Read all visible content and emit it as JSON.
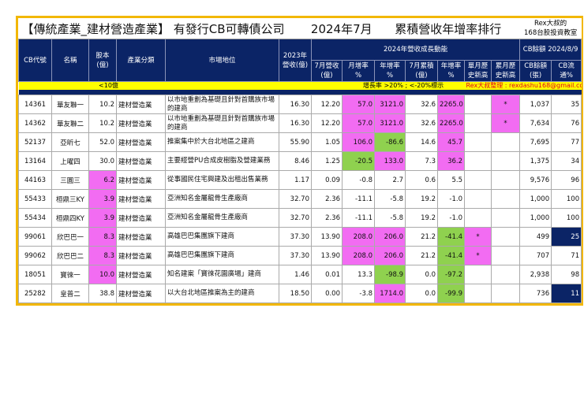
{
  "title": {
    "text": "【傳統產業_建材營造產業】 有發行CB可轉債公司       2024年7月      累積營收年增率排行",
    "brand_line1": "Rex大叔的",
    "brand_line2": "168台股投資教室"
  },
  "header": {
    "cb_code": "CB代號",
    "name": "名稱",
    "capital": "股本(億)",
    "industry": "產業分類",
    "market": "市場地位",
    "rev2023": "2023年營收(億)",
    "group2024": "2024年營收成長動能",
    "group_cb": "CB餘額 2024/8/9",
    "jul_rev": "7月營收(億)",
    "mom": "月增率 %",
    "yoy": "年增率 %",
    "jul_cum": "7月累積(億)",
    "cum_yoy": "年增率 %",
    "month_high": "單月歷史新高",
    "cum_high": "累月歷史新高",
    "cb_bal": "CB餘額(張)",
    "cb_float": "CB流通%"
  },
  "legend": {
    "small_cap": "<10億",
    "growth_note": "增長率 >20% ; <-20%標示",
    "contact": "Rex大叔整理 : rexdashu168@gmail.com"
  },
  "colors": {
    "pink": "#f26cf2",
    "green": "#8fd14f",
    "navy": "#0b2466",
    "border": "#f2b705"
  },
  "rows": [
    {
      "code": "14361",
      "name": "華友聯一",
      "capital": "10.2",
      "industry": "建材營造業",
      "market": "以市地重劃為基礎且針對首購族市場的建商",
      "rev2023": "16.30",
      "jul_rev": "12.20",
      "mom": "57.0",
      "yoy": "3121.0",
      "jul_cum": "32.6",
      "cum_yoy": "2265.0",
      "month_high": "",
      "cum_high": "*",
      "cb_bal": "1,037",
      "cb_float": "35",
      "hl": {
        "mom": "pink",
        "yoy": "pink",
        "cum_yoy": "pink",
        "cum_high": "pink"
      }
    },
    {
      "code": "14362",
      "name": "華友聯二",
      "capital": "10.2",
      "industry": "建材營造業",
      "market": "以市地重劃為基礎且針對首購族市場的建商",
      "rev2023": "16.30",
      "jul_rev": "12.20",
      "mom": "57.0",
      "yoy": "3121.0",
      "jul_cum": "32.6",
      "cum_yoy": "2265.0",
      "month_high": "",
      "cum_high": "*",
      "cb_bal": "7,634",
      "cb_float": "76",
      "hl": {
        "mom": "pink",
        "yoy": "pink",
        "cum_yoy": "pink",
        "cum_high": "pink"
      }
    },
    {
      "code": "52137",
      "name": "亞昕七",
      "capital": "52.0",
      "industry": "建材營造業",
      "market": "推案集中於大台北地區之建商",
      "rev2023": "55.90",
      "jul_rev": "1.05",
      "mom": "106.0",
      "yoy": "-86.6",
      "jul_cum": "14.6",
      "cum_yoy": "45.7",
      "month_high": "",
      "cum_high": "",
      "cb_bal": "7,695",
      "cb_float": "77",
      "hl": {
        "mom": "pink",
        "yoy": "green",
        "cum_yoy": "pink"
      }
    },
    {
      "code": "13164",
      "name": "上曜四",
      "capital": "30.0",
      "industry": "建材營造業",
      "market": "主要經營PU合成皮樹脂及營建業務",
      "rev2023": "8.46",
      "jul_rev": "1.25",
      "mom": "-20.5",
      "yoy": "133.0",
      "jul_cum": "7.3",
      "cum_yoy": "36.2",
      "month_high": "",
      "cum_high": "",
      "cb_bal": "1,375",
      "cb_float": "34",
      "hl": {
        "mom": "green",
        "yoy": "pink",
        "cum_yoy": "pink"
      }
    },
    {
      "code": "44163",
      "name": "三圓三",
      "capital": "6.2",
      "industry": "建材營造業",
      "market": "從事國民住宅興建及出租出售業務",
      "rev2023": "1.17",
      "jul_rev": "0.09",
      "mom": "-0.8",
      "yoy": "2.7",
      "jul_cum": "0.6",
      "cum_yoy": "5.5",
      "month_high": "",
      "cum_high": "",
      "cb_bal": "9,576",
      "cb_float": "96",
      "hl": {
        "capital": "pink"
      }
    },
    {
      "code": "55433",
      "name": "桓鼎三KY",
      "capital": "3.9",
      "industry": "建材營造業",
      "market": "亞洲知名金屬龍骨生產廠商",
      "rev2023": "32.70",
      "jul_rev": "2.36",
      "mom": "-11.1",
      "yoy": "-5.8",
      "jul_cum": "19.2",
      "cum_yoy": "-1.0",
      "month_high": "",
      "cum_high": "",
      "cb_bal": "1,000",
      "cb_float": "100",
      "hl": {
        "capital": "pink"
      }
    },
    {
      "code": "55434",
      "name": "桓鼎四KY",
      "capital": "3.9",
      "industry": "建材營造業",
      "market": "亞洲知名金屬龍骨生產廠商",
      "rev2023": "32.70",
      "jul_rev": "2.36",
      "mom": "-11.1",
      "yoy": "-5.8",
      "jul_cum": "19.2",
      "cum_yoy": "-1.0",
      "month_high": "",
      "cum_high": "",
      "cb_bal": "1,000",
      "cb_float": "100",
      "hl": {
        "capital": "pink"
      }
    },
    {
      "code": "99061",
      "name": "欣巴巴一",
      "capital": "8.3",
      "industry": "建材營造業",
      "market": "高雄巴巴集團旗下建商",
      "rev2023": "37.30",
      "jul_rev": "13.90",
      "mom": "208.0",
      "yoy": "206.0",
      "jul_cum": "21.2",
      "cum_yoy": "-41.4",
      "month_high": "*",
      "cum_high": "",
      "cb_bal": "499",
      "cb_float": "25",
      "hl": {
        "capital": "pink",
        "mom": "pink",
        "yoy": "pink",
        "cum_yoy": "green",
        "month_high": "pink",
        "cb_float": "navy"
      }
    },
    {
      "code": "99062",
      "name": "欣巴巴二",
      "capital": "8.3",
      "industry": "建材營造業",
      "market": "高雄巴巴集團旗下建商",
      "rev2023": "37.30",
      "jul_rev": "13.90",
      "mom": "208.0",
      "yoy": "206.0",
      "jul_cum": "21.2",
      "cum_yoy": "-41.4",
      "month_high": "*",
      "cum_high": "",
      "cb_bal": "707",
      "cb_float": "71",
      "hl": {
        "capital": "pink",
        "mom": "pink",
        "yoy": "pink",
        "cum_yoy": "green",
        "month_high": "pink"
      }
    },
    {
      "code": "18051",
      "name": "寶徠一",
      "capital": "10.0",
      "industry": "建材營造業",
      "market": "知名建案「寶徠花園廣場」建商",
      "rev2023": "1.46",
      "jul_rev": "0.01",
      "mom": "13.3",
      "yoy": "-98.9",
      "jul_cum": "0.0",
      "cum_yoy": "-97.2",
      "month_high": "",
      "cum_high": "",
      "cb_bal": "2,938",
      "cb_float": "98",
      "hl": {
        "capital": "pink",
        "yoy": "green",
        "cum_yoy": "green"
      }
    },
    {
      "code": "25282",
      "name": "皇普二",
      "capital": "38.8",
      "industry": "建材營造業",
      "market": "以大台北地區推案為主的建商",
      "rev2023": "18.50",
      "jul_rev": "0.00",
      "mom": "-3.8",
      "yoy": "1714.0",
      "jul_cum": "0.0",
      "cum_yoy": "-99.9",
      "month_high": "",
      "cum_high": "",
      "cb_bal": "736",
      "cb_float": "11",
      "hl": {
        "yoy": "pink",
        "cum_yoy": "green",
        "cb_float": "navy"
      }
    }
  ]
}
